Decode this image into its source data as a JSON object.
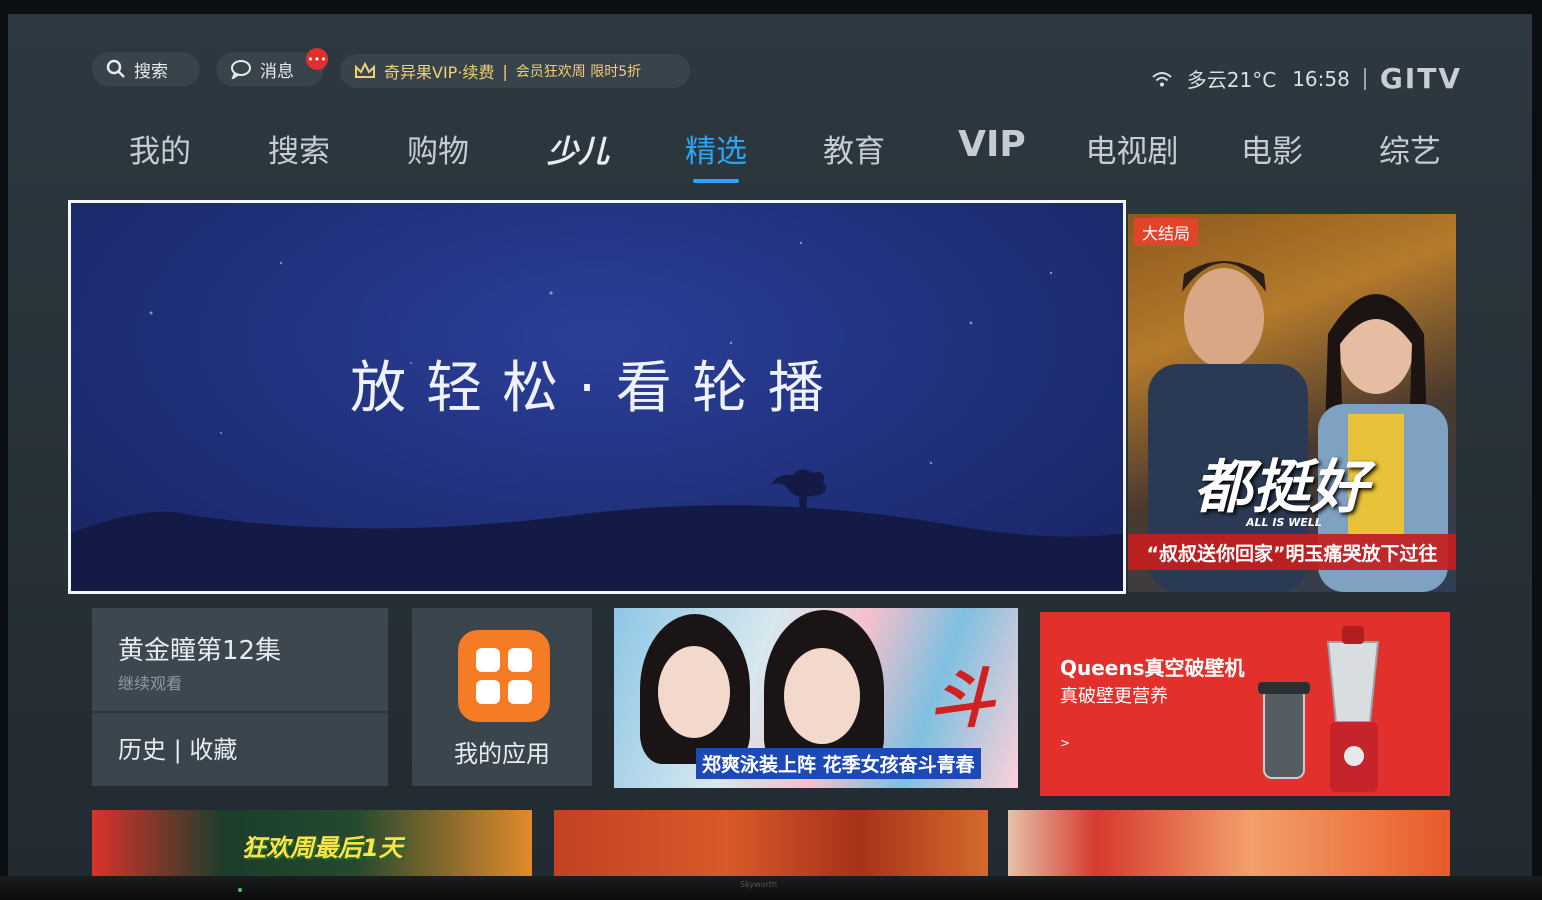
{
  "topbar": {
    "search_label": "搜索",
    "messages_label": "消息",
    "messages_badge": "•••",
    "vip_label": "奇异果VIP·续费",
    "vip_separator": "|",
    "vip_promo": "会员狂欢周 限时5折"
  },
  "status": {
    "weather": "多云21°C",
    "time": "16:58",
    "brand_logo": "GITV"
  },
  "nav": {
    "items": [
      {
        "label": "我的",
        "active": false
      },
      {
        "label": "搜索",
        "active": false
      },
      {
        "label": "购物",
        "active": false
      },
      {
        "label": "少儿",
        "active": false
      },
      {
        "label": "精选",
        "active": true
      },
      {
        "label": "教育",
        "active": false
      },
      {
        "label": "VIP",
        "active": false
      },
      {
        "label": "电视剧",
        "active": false
      },
      {
        "label": "电影",
        "active": false
      },
      {
        "label": "综艺",
        "active": false
      }
    ]
  },
  "hero": {
    "text": "放轻松·看轮播"
  },
  "side_card": {
    "badge": "大结局",
    "title": "都挺好",
    "subtitle": "ALL IS WELL",
    "caption": "“叔叔送你回家”明玉痛哭放下过往"
  },
  "history": {
    "title": "黄金瞳第12集",
    "subtitle": "继续观看",
    "links": "历史 | 收藏"
  },
  "apps": {
    "label": "我的应用"
  },
  "promo": {
    "logo": "斗",
    "caption": "郑爽泳装上阵 花季女孩奋斗青春"
  },
  "ad": {
    "title": "Queens真空破壁机",
    "subtitle": "真破壁更营养",
    "arrow": ">"
  },
  "row3": {
    "banner_text": "狂欢周最后1天"
  },
  "bezel": {
    "brand": "Skyworth"
  },
  "colors": {
    "accent": "#2aa4f4",
    "vip_gold": "#f1cf72",
    "apps_orange": "#f57b24",
    "ad_red": "#e2302c"
  }
}
